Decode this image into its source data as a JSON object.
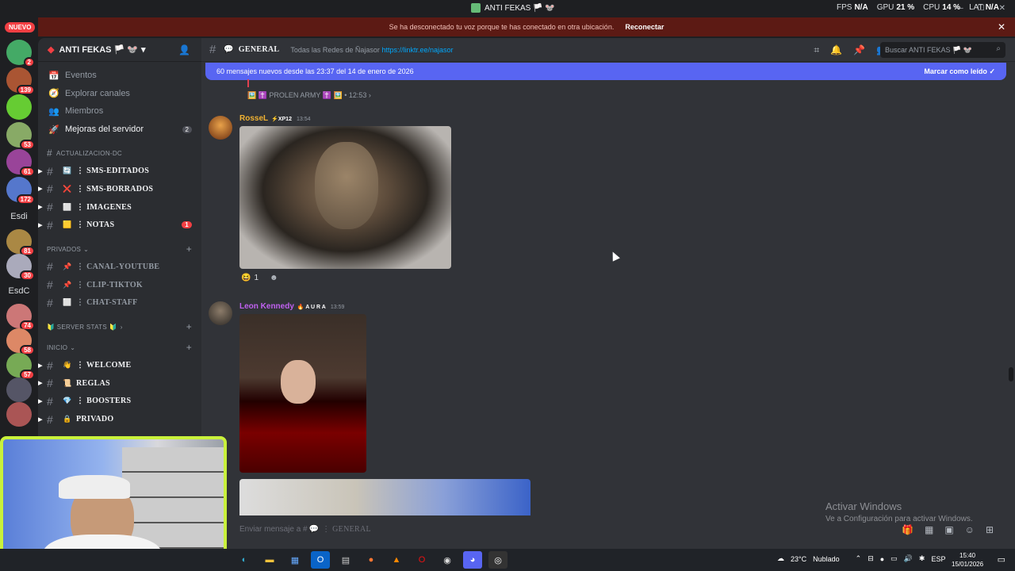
{
  "window": {
    "title": "ANTI FEKAS 🏳️ 🐭",
    "fps_label": "FPS",
    "fps": "N/A",
    "gpu_label": "GPU",
    "gpu": "21 %",
    "cpu_label": "CPU",
    "cpu": "14 %",
    "lat_label": "LAT",
    "lat": "N/A"
  },
  "disconnect": {
    "text": "Se ha desconectado tu voz porque te has conectado en otra ubicación.",
    "button": "Reconectar"
  },
  "guilds": {
    "nuevo": "NUEVO",
    "items": [
      {
        "badge": "2"
      },
      {
        "badge": "139"
      },
      {
        "badge": ""
      },
      {
        "badge": "53"
      },
      {
        "badge": "61"
      },
      {
        "badge": "172"
      },
      {
        "text": "Esdi"
      },
      {
        "badge": "81"
      },
      {
        "badge": "30"
      },
      {
        "text": "EsdC"
      },
      {
        "badge": "74"
      },
      {
        "badge": "58"
      },
      {
        "badge": "57"
      },
      {
        "badge": ""
      },
      {
        "badge": ""
      }
    ]
  },
  "server": {
    "name": "ANTI FEKAS 🏳️ 🐭"
  },
  "sidebar": {
    "links": [
      {
        "icon": "📅",
        "label": "Eventos"
      },
      {
        "icon": "🧭",
        "label": "Explorar canales"
      },
      {
        "icon": "👥",
        "label": "Miembros"
      },
      {
        "icon": "🚀",
        "label": "Mejoras del servidor",
        "count": "2"
      }
    ],
    "cat1": "ACTUALIZACION-DC",
    "cat1_channels": [
      {
        "emoji": "🔄",
        "name": "⋮ SMS-EDITADOS"
      },
      {
        "emoji": "❌",
        "name": "⋮ SMS-BORRADOS"
      },
      {
        "emoji": "⬜",
        "name": "⋮ IMAGENES"
      },
      {
        "emoji": "🟨",
        "name": "⋮ NOTAS",
        "badge": "1"
      }
    ],
    "cat2": "PRIVADOS",
    "cat2_channels": [
      {
        "emoji": "📌",
        "name": "⋮ CANAL-YOUTUBE"
      },
      {
        "emoji": "📌",
        "name": "⋮ CLIP-TIKTOK"
      },
      {
        "emoji": "⬜",
        "name": "⋮ CHAT-STAFF"
      }
    ],
    "cat3": "🔰 SERVER STATS 🔰",
    "cat4": "INICIO",
    "cat4_channels": [
      {
        "emoji": "👋",
        "name": "⋮ WELCOME"
      },
      {
        "emoji": "📜",
        "name": "REGLAS"
      },
      {
        "emoji": "💎",
        "name": "⋮ BOOSTERS"
      },
      {
        "emoji": "🔒",
        "name": "PRIVADO"
      }
    ]
  },
  "channel": {
    "name": "GENERAL",
    "topic": "Todas las Redes de Ñajasor",
    "link": "https://linktr.ee/najasor"
  },
  "search": {
    "placeholder": "Buscar ANTI FEKAS 🏳️ 🐭"
  },
  "newbar": {
    "text": "60 mensajes nuevos desde las 23:37 del 14 de enero de 2026",
    "action": "Marcar como leído"
  },
  "thread": {
    "label": "🖼️ ✝️ PROLEN ARMY ✝️ 🖼️",
    "time": "12:53"
  },
  "messages": [
    {
      "user": "RosseL",
      "tag": "⚡XP12",
      "time": "13:54",
      "reaction": "😆",
      "reaction_count": "1",
      "color": "#f0b232"
    },
    {
      "user": "Leon Kennedy",
      "tag": "🔥 A U R A",
      "time": "13:59",
      "color": "#c061f0"
    }
  ],
  "input": {
    "placeholder": "Enviar mensaje a #",
    "channel": "⋮ GENERAL"
  },
  "activation": {
    "title": "Activar Windows",
    "subtitle": "Ve a Configuración para activar Windows."
  },
  "taskbar": {
    "weather": "23°C",
    "weather_desc": "Nublado",
    "lang": "ESP",
    "time": "15:40",
    "date": "15/01/2026"
  }
}
